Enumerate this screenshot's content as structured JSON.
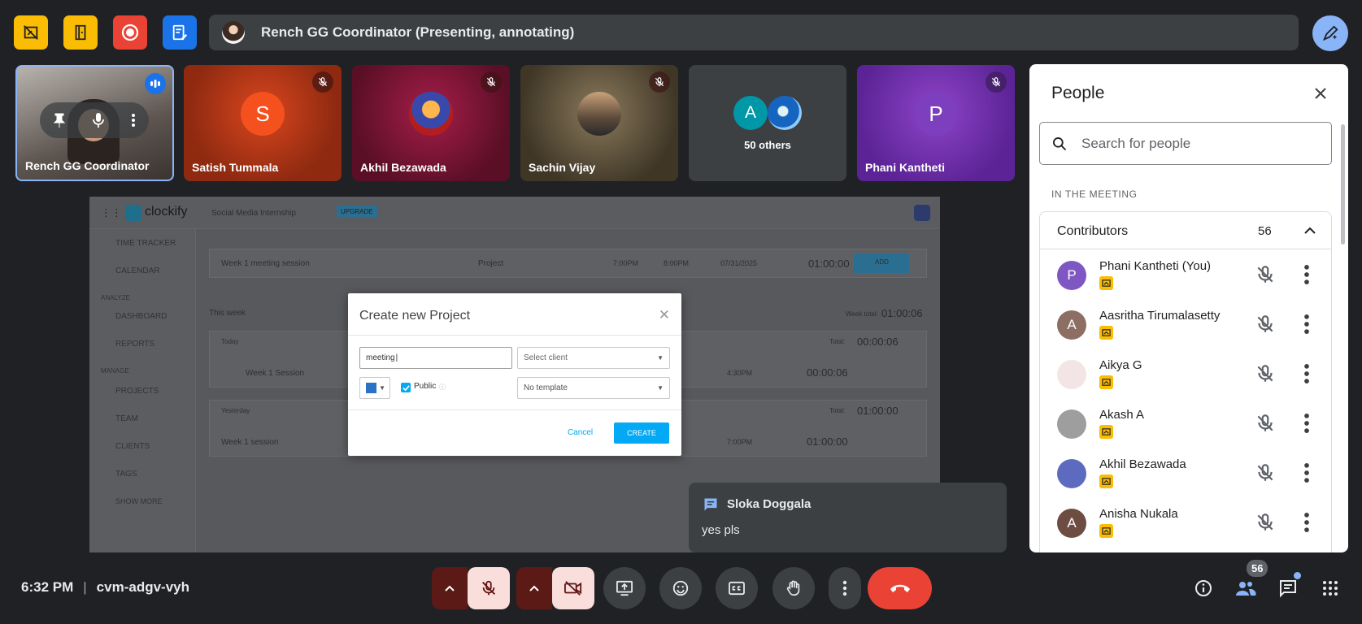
{
  "presenter": {
    "text": "Rench GG Coordinator (Presenting, annotating)"
  },
  "tiles": [
    {
      "name": "Rench GG Coordinator"
    },
    {
      "name": "Satish Tummala",
      "initial": "S"
    },
    {
      "name": "Akhil Bezawada"
    },
    {
      "name": "Sachin Vijay"
    },
    {
      "name": "50 others",
      "initial": "A"
    },
    {
      "name": "Phani Kantheti",
      "initial": "P"
    }
  ],
  "clockify": {
    "logo": "clockify",
    "workspace": "Social Media Internship",
    "upgrade": "UPGRADE",
    "sidebar": [
      "TIME TRACKER",
      "CALENDAR",
      "ANALYZE",
      "DASHBOARD",
      "REPORTS",
      "MANAGE",
      "PROJECTS",
      "TEAM",
      "CLIENTS",
      "TAGS",
      "SHOW MORE"
    ],
    "entry": {
      "description": "Week 1 meeting session",
      "project": "Project",
      "start": "7:00PM",
      "end": "8:00PM",
      "date": "07/31/2025",
      "duration": "01:00:00",
      "add": "ADD"
    },
    "week_label": "This week",
    "week_total_label": "Week total:",
    "week_total": "01:00:06",
    "groups": [
      {
        "day": "Today",
        "total_label": "Total:",
        "total": "00:00:06",
        "row": {
          "name": "Week 1 Session",
          "end": "4:30PM",
          "duration": "00:00:06"
        }
      },
      {
        "day": "Yesterday",
        "total_label": "Total:",
        "total": "01:00:00",
        "row": {
          "name": "Week 1 session",
          "end": "7:00PM",
          "duration": "01:00:00"
        }
      }
    ]
  },
  "modal": {
    "title": "Create new Project",
    "name_value": "meeting",
    "client_placeholder": "Select client",
    "public_label": "Public",
    "template_placeholder": "No template",
    "cancel": "Cancel",
    "create": "CREATE"
  },
  "chat_toast": {
    "sender": "Sloka Doggala",
    "message": "yes pls"
  },
  "people_panel": {
    "title": "People",
    "search_placeholder": "Search for people",
    "section_label": "IN THE MEETING",
    "group_label": "Contributors",
    "group_count": "56",
    "people": [
      {
        "name": "Phani Kantheti (You)",
        "initial": "P",
        "color": "#7e57c2"
      },
      {
        "name": "Aasritha Tirumalasetty",
        "initial": "A",
        "color": "#8d6e63"
      },
      {
        "name": "Aikya G",
        "initial": "",
        "color": "#f3e5e5"
      },
      {
        "name": "Akash A",
        "initial": "",
        "color": "#9e9e9e"
      },
      {
        "name": "Akhil Bezawada",
        "initial": "",
        "color": "#5c6bc0"
      },
      {
        "name": "Anisha Nukala",
        "initial": "A",
        "color": "#6d4c41"
      }
    ]
  },
  "bottom_bar": {
    "time": "6:32 PM",
    "separator": "|",
    "meeting_code": "cvm-adgv-vyh",
    "participant_count": "56"
  }
}
